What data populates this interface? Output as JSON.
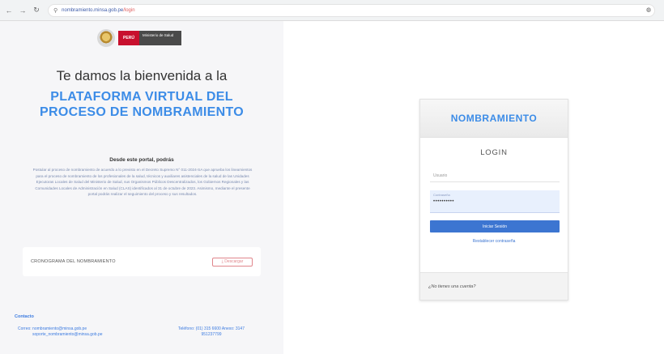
{
  "browser": {
    "back_glyph": "←",
    "forward_glyph": "→",
    "reload_glyph": "↻",
    "lock_glyph": "⚲",
    "url_host": "nombramiento.minsa.gob.pe",
    "url_path": "/login",
    "profile_glyph": "◍"
  },
  "left": {
    "logo_red_text": "PERÚ",
    "logo_dark_text": "Ministerio de Salud",
    "welcome": "Te damos la bienvenida a la",
    "platform_line1": "PLATAFORMA VIRTUAL DEL",
    "platform_line2": "PROCESO DE NOMBRAMIENTO",
    "desc_title": "Desde este portal, podrás",
    "description": "Postular al proceso de nombramiento de acuerdo a lo previsto en el Decreto Supremo N° 011-2024-SA que aprueba los lineamientos para el proceso de nombramiento de los profesionales de la salud, técnicos y auxiliares asistenciales de la salud de las Unidades Ejecutoras Locales de Salud del Ministerio de Salud, sus Organismos Públicos Descentralizados, los Gobiernos Regionales y las Comunidades Locales de Administración en Salud (CLAS) identificados al 31 de octubre de 2023. Asimismo, mediante el presente portal podrás realizar el seguimiento del proceso y sus resultados.",
    "cronograma_label": "CRONOGRAMA DEL NOMBRAMIENTO",
    "cronograma_button": "⤓ Descargar",
    "contact_head": "Contacto",
    "contact_email_1": "Correo: nombramiento@minsa.gob.pe",
    "contact_email_2": "soporte_nombramiento@minsa.gob.pe",
    "contact_phone_1": "Teléfono: (01) 315 6600 Anexo: 3147",
    "contact_phone_2": "951237799"
  },
  "login": {
    "header": "NOMBRAMIENTO",
    "title": "LOGIN",
    "user_placeholder": "Usuario",
    "pass_label": "Contraseña",
    "pass_value": "••••••••••",
    "login_button": "Iniciar Sesión",
    "forgot": "Restablecer contraseña",
    "footer": "¿No tienes una cuenta?"
  }
}
